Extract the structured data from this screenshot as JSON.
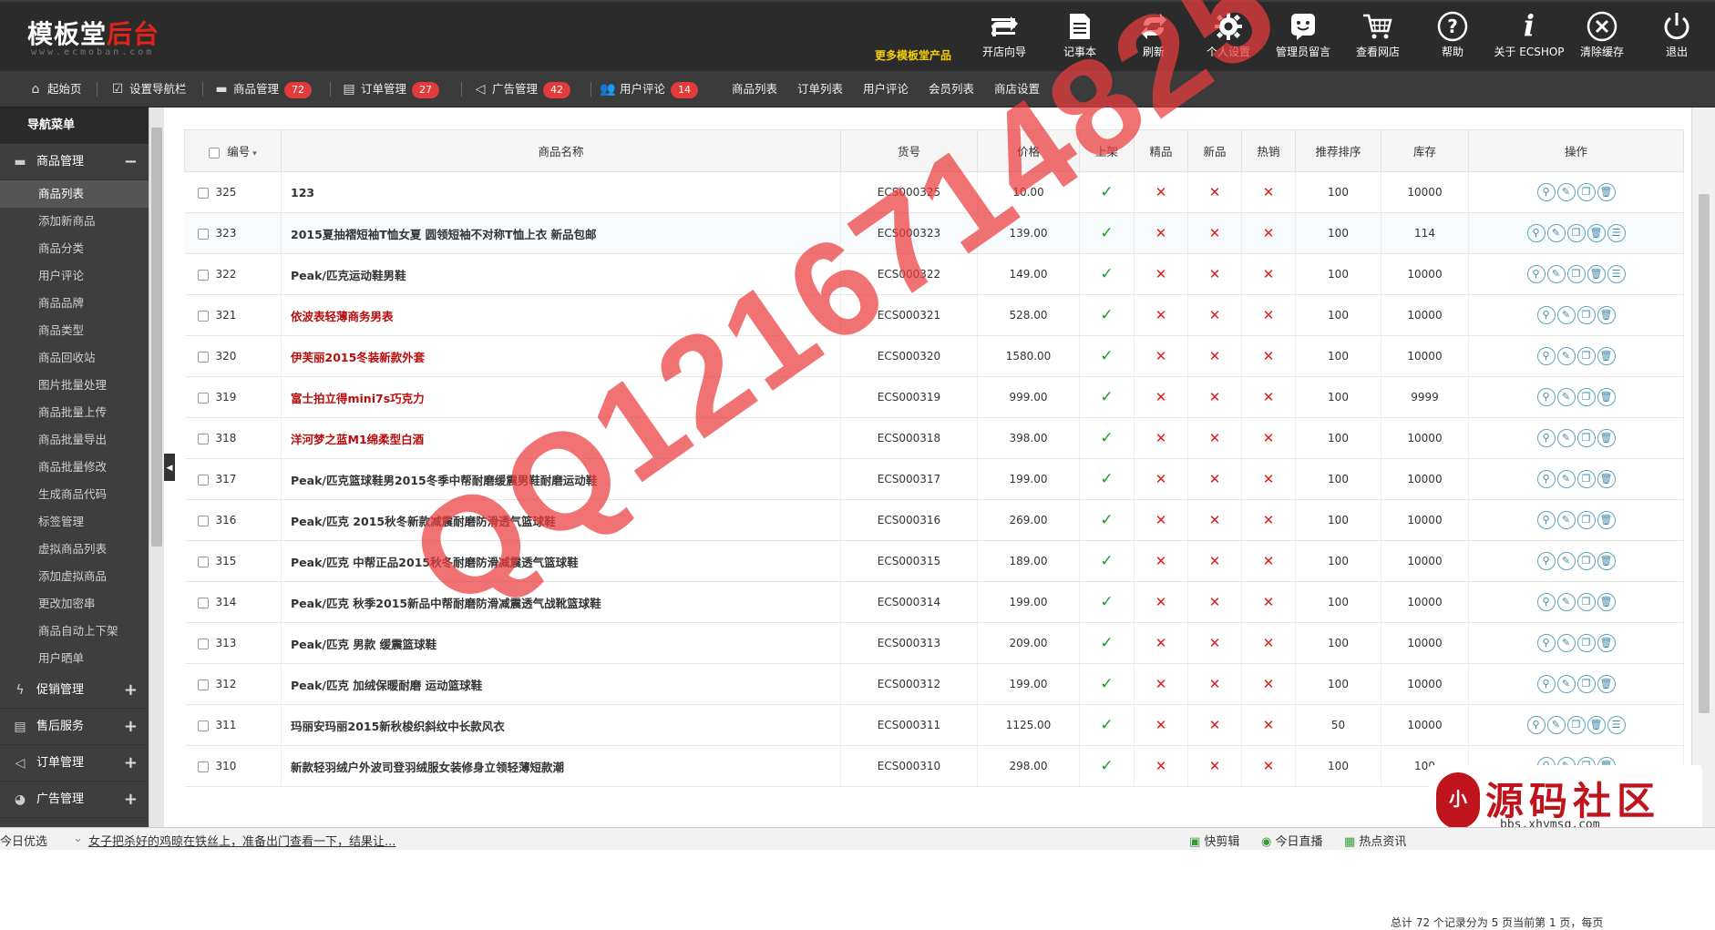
{
  "brand": {
    "logo_main": "模板堂",
    "logo_accent": "后台",
    "logo_sub": "www.ecmoban.com",
    "more_products": "更多模板堂产品"
  },
  "toolbar": [
    {
      "label": "开店向导",
      "icon": "arrow-forward-icon"
    },
    {
      "label": "记事本",
      "icon": "notepad-icon"
    },
    {
      "label": "刷新",
      "icon": "refresh-icon"
    },
    {
      "label": "个人设置",
      "icon": "gear-icon"
    },
    {
      "label": "管理员留言",
      "icon": "message-icon"
    },
    {
      "label": "查看网店",
      "icon": "cart-icon"
    },
    {
      "label": "帮助",
      "icon": "help-icon"
    },
    {
      "label": "关于 ECSHOP",
      "icon": "info-icon"
    },
    {
      "label": "清除缓存",
      "icon": "clear-cache-icon"
    },
    {
      "label": "退出",
      "icon": "power-icon"
    }
  ],
  "nav": {
    "home": "起始页",
    "setnav": "设置导航栏",
    "goods": "商品管理",
    "goods_count": "72",
    "orders": "订单管理",
    "orders_count": "27",
    "ads": "广告管理",
    "ads_count": "42",
    "comments": "用户评论",
    "comments_count": "14",
    "goods_list": "商品列表",
    "order_list": "订单列表",
    "user_comments": "用户评论",
    "member_list": "会员列表",
    "shop_settings": "商店设置"
  },
  "sidebar": {
    "title": "导航菜单",
    "goods_section": "商品管理",
    "items": [
      "商品列表",
      "添加新商品",
      "商品分类",
      "用户评论",
      "商品品牌",
      "商品类型",
      "商品回收站",
      "图片批量处理",
      "商品批量上传",
      "商品批量导出",
      "商品批量修改",
      "生成商品代码",
      "标签管理",
      "虚拟商品列表",
      "添加虚拟商品",
      "更改加密串",
      "商品自动上下架",
      "用户晒单"
    ],
    "sections": [
      "促销管理",
      "售后服务",
      "订单管理",
      "广告管理"
    ]
  },
  "table": {
    "headers": [
      "编号",
      "商品名称",
      "货号",
      "价格",
      "上架",
      "精品",
      "新品",
      "热销",
      "推荐排序",
      "库存",
      "操作"
    ],
    "rows": [
      {
        "id": "325",
        "name": "123",
        "red": false,
        "sn": "ECS000325",
        "price": "10.00",
        "sort": "100",
        "stock": "10000",
        "ops": 4
      },
      {
        "id": "323",
        "name": "2015夏抽褶短袖T恤女夏 圆领短袖不对称T恤上衣 新品包邮",
        "red": false,
        "sn": "ECS000323",
        "price": "139.00",
        "sort": "100",
        "stock": "114",
        "ops": 5
      },
      {
        "id": "322",
        "name": "Peak/匹克运动鞋男鞋",
        "red": false,
        "sn": "ECS000322",
        "price": "149.00",
        "sort": "100",
        "stock": "10000",
        "ops": 5
      },
      {
        "id": "321",
        "name": "依波表轻薄商务男表",
        "red": true,
        "sn": "ECS000321",
        "price": "528.00",
        "sort": "100",
        "stock": "10000",
        "ops": 4
      },
      {
        "id": "320",
        "name": "伊芙丽2015冬装新款外套",
        "red": true,
        "sn": "ECS000320",
        "price": "1580.00",
        "sort": "100",
        "stock": "10000",
        "ops": 4
      },
      {
        "id": "319",
        "name": "富士拍立得mini7s巧克力",
        "red": true,
        "sn": "ECS000319",
        "price": "999.00",
        "sort": "100",
        "stock": "9999",
        "ops": 4
      },
      {
        "id": "318",
        "name": "洋河梦之蓝M1绵柔型白酒",
        "red": true,
        "sn": "ECS000318",
        "price": "398.00",
        "sort": "100",
        "stock": "10000",
        "ops": 4
      },
      {
        "id": "317",
        "name": "Peak/匹克篮球鞋男2015冬季中帮耐磨缓震男鞋耐磨运动鞋",
        "red": false,
        "sn": "ECS000317",
        "price": "199.00",
        "sort": "100",
        "stock": "10000",
        "ops": 4
      },
      {
        "id": "316",
        "name": "Peak/匹克 2015秋冬新款减震耐磨防滑透气篮球鞋",
        "red": false,
        "sn": "ECS000316",
        "price": "269.00",
        "sort": "100",
        "stock": "10000",
        "ops": 4
      },
      {
        "id": "315",
        "name": "Peak/匹克 中帮正品2015秋冬耐磨防滑减震透气篮球鞋",
        "red": false,
        "sn": "ECS000315",
        "price": "189.00",
        "sort": "100",
        "stock": "10000",
        "ops": 4
      },
      {
        "id": "314",
        "name": "Peak/匹克 秋季2015新品中帮耐磨防滑减震透气战靴篮球鞋",
        "red": false,
        "sn": "ECS000314",
        "price": "199.00",
        "sort": "100",
        "stock": "10000",
        "ops": 4
      },
      {
        "id": "313",
        "name": "Peak/匹克 男款 缓震篮球鞋",
        "red": false,
        "sn": "ECS000313",
        "price": "209.00",
        "sort": "100",
        "stock": "10000",
        "ops": 4
      },
      {
        "id": "312",
        "name": "Peak/匹克 加绒保暖耐磨 运动篮球鞋",
        "red": false,
        "sn": "ECS000312",
        "price": "199.00",
        "sort": "100",
        "stock": "10000",
        "ops": 4
      },
      {
        "id": "311",
        "name": "玛丽安玛丽2015新秋梭织斜纹中长款风衣",
        "red": false,
        "sn": "ECS000311",
        "price": "1125.00",
        "sort": "50",
        "stock": "10000",
        "ops": 5
      },
      {
        "id": "310",
        "name": "新款轻羽绒户外波司登羽绒服女装修身立领轻薄短款潮",
        "red": false,
        "sn": "ECS000310",
        "price": "298.00",
        "sort": "100",
        "stock": "100",
        "ops": 4
      }
    ]
  },
  "pager": "总计 72 个记录分为 5 页当前第 1 页，每页",
  "statusbar": {
    "left": "今日优选",
    "news": "女子把杀好的鸡晾在铁丝上，准备出门查看一下，结果让...",
    "item1": "快剪辑",
    "item2": "今日直播",
    "item3": "热点资讯"
  },
  "watermark": "QQ1216714825",
  "watermark_logo": {
    "text": "源码社区",
    "url": "bbs.xhymsq.com",
    "mascot": "小"
  }
}
